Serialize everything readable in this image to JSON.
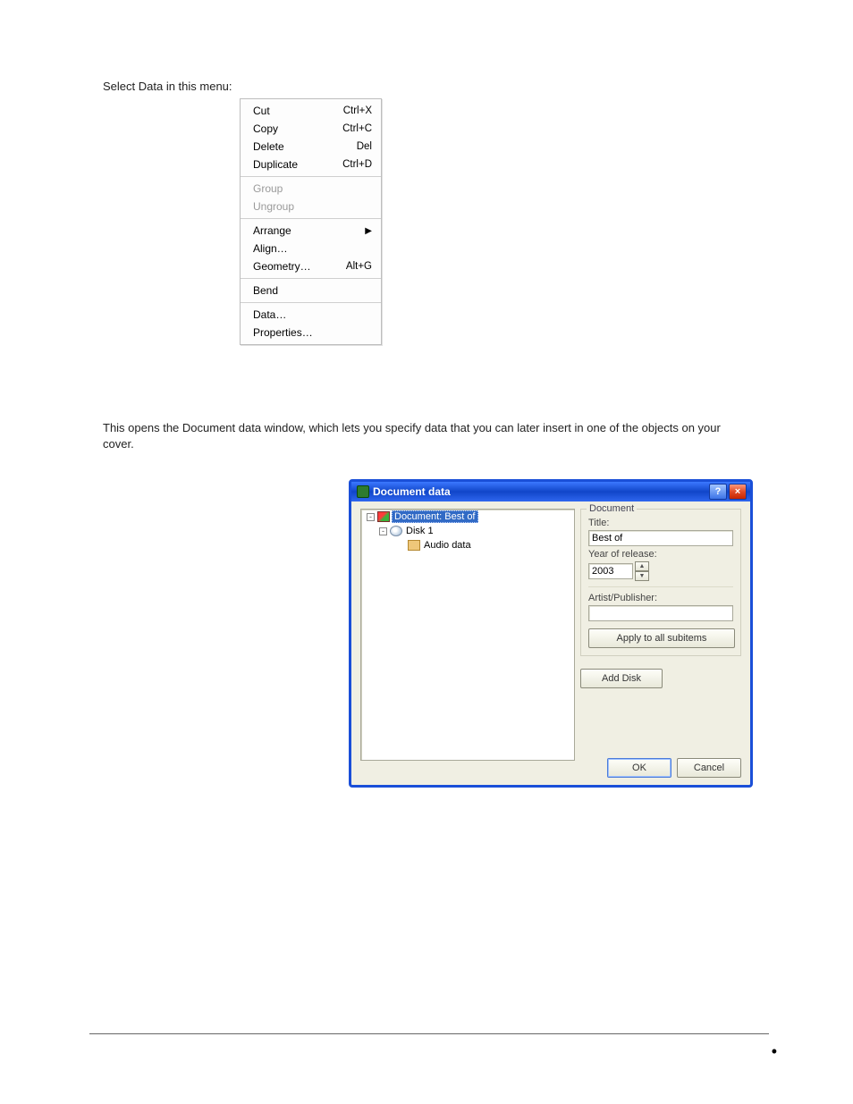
{
  "body_paragraphs": {
    "p1": "Select Data in this menu:",
    "p2": "This opens the Document data window, which lets you specify data that you can later insert in one of the objects on your cover."
  },
  "context_menu": {
    "groups": [
      {
        "items": [
          {
            "label": "Cut",
            "shortcut": "Ctrl+X",
            "disabled": false,
            "submenu": false
          },
          {
            "label": "Copy",
            "shortcut": "Ctrl+C",
            "disabled": false,
            "submenu": false
          },
          {
            "label": "Delete",
            "shortcut": "Del",
            "disabled": false,
            "submenu": false
          },
          {
            "label": "Duplicate",
            "shortcut": "Ctrl+D",
            "disabled": false,
            "submenu": false
          }
        ]
      },
      {
        "items": [
          {
            "label": "Group",
            "shortcut": "",
            "disabled": true,
            "submenu": false
          },
          {
            "label": "Ungroup",
            "shortcut": "",
            "disabled": true,
            "submenu": false
          }
        ]
      },
      {
        "items": [
          {
            "label": "Arrange",
            "shortcut": "",
            "disabled": false,
            "submenu": true
          },
          {
            "label": "Align…",
            "shortcut": "",
            "disabled": false,
            "submenu": false
          },
          {
            "label": "Geometry…",
            "shortcut": "Alt+G",
            "disabled": false,
            "submenu": false
          }
        ]
      },
      {
        "items": [
          {
            "label": "Bend",
            "shortcut": "",
            "disabled": false,
            "submenu": false
          }
        ]
      },
      {
        "items": [
          {
            "label": "Data…",
            "shortcut": "",
            "disabled": false,
            "submenu": false
          },
          {
            "label": "Properties…",
            "shortcut": "",
            "disabled": false,
            "submenu": false
          }
        ]
      }
    ]
  },
  "dialog": {
    "title": "Document data",
    "help_btn": "?",
    "close_btn": "×",
    "tree": [
      {
        "level": 0,
        "toggle": "-",
        "icon": "doc",
        "label": "Document: Best of",
        "selected": true
      },
      {
        "level": 1,
        "toggle": "-",
        "icon": "disk",
        "label": "Disk 1",
        "selected": false
      },
      {
        "level": 2,
        "toggle": "",
        "icon": "audio",
        "label": "Audio data",
        "selected": false
      }
    ],
    "group_legend": "Document",
    "title_lbl": "Title:",
    "title_val": "Best of",
    "year_lbl": "Year of release:",
    "year_val": "2003",
    "artist_lbl": "Artist/Publisher:",
    "artist_val": "",
    "apply_btn": "Apply to all subitems",
    "add_disk_btn": "Add Disk",
    "ok_btn": "OK",
    "cancel_btn": "Cancel"
  }
}
